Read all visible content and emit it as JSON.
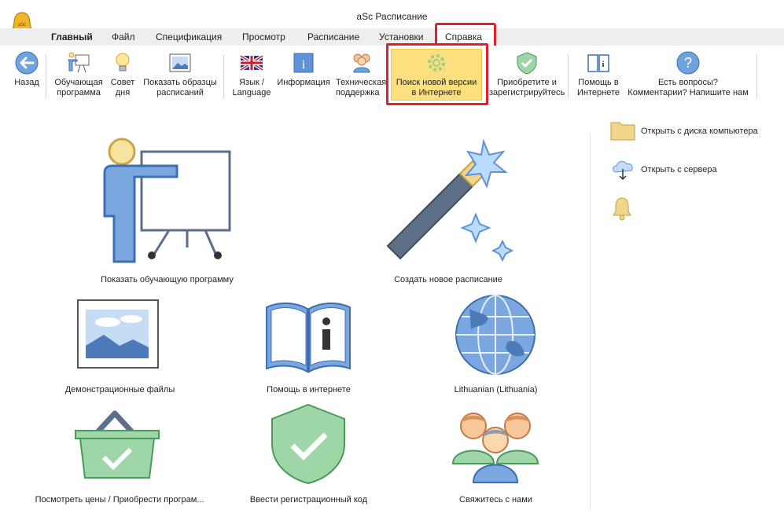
{
  "window": {
    "title": "aSc Расписание"
  },
  "menu": {
    "tabs": [
      "Главный",
      "Файл",
      "Спецификация",
      "Просмотр",
      "Расписание",
      "Установки",
      "Справка"
    ],
    "active_tab": "Справка"
  },
  "ribbon": {
    "back": "Назад",
    "training_1": "Обучающая",
    "training_2": "программа",
    "tip_1": "Совет",
    "tip_2": "дня",
    "samples_1": "Показать образцы",
    "samples_2": "расписаний",
    "lang_1": "Язык /",
    "lang_2": "Language",
    "info": "Информация",
    "support_1": "Техническая",
    "support_2": "поддержка",
    "update_1": "Поиск новой версии",
    "update_2": "в Интернете",
    "register_1": "Приобретите и",
    "register_2": "зарегистрируйтесь",
    "help_1": "Помощь в",
    "help_2": "Интернете",
    "questions_1": "Есть вопросы?",
    "questions_2": "Комментарии? Напишите нам"
  },
  "tiles": {
    "training": "Показать обучающую программу",
    "new_timetable": "Создать новое расписание",
    "demo_files": "Демонстрационные файлы",
    "online_help": "Помощь в интернете",
    "language": "Lithuanian (Lithuania)",
    "buy": "Посмотреть цены / Приобрести програм...",
    "reg_code": "Ввести регистрационный код",
    "contact": "Свяжитесь с нами"
  },
  "side": {
    "open_disk": "Открыть с диска компьютера",
    "open_server": "Открыть с сервера"
  },
  "colors": {
    "highlight": "#fcdf7f",
    "annotation": "#e0202c",
    "menu_bg": "#eeeeee",
    "icon_blue": "#7aa7e0"
  }
}
